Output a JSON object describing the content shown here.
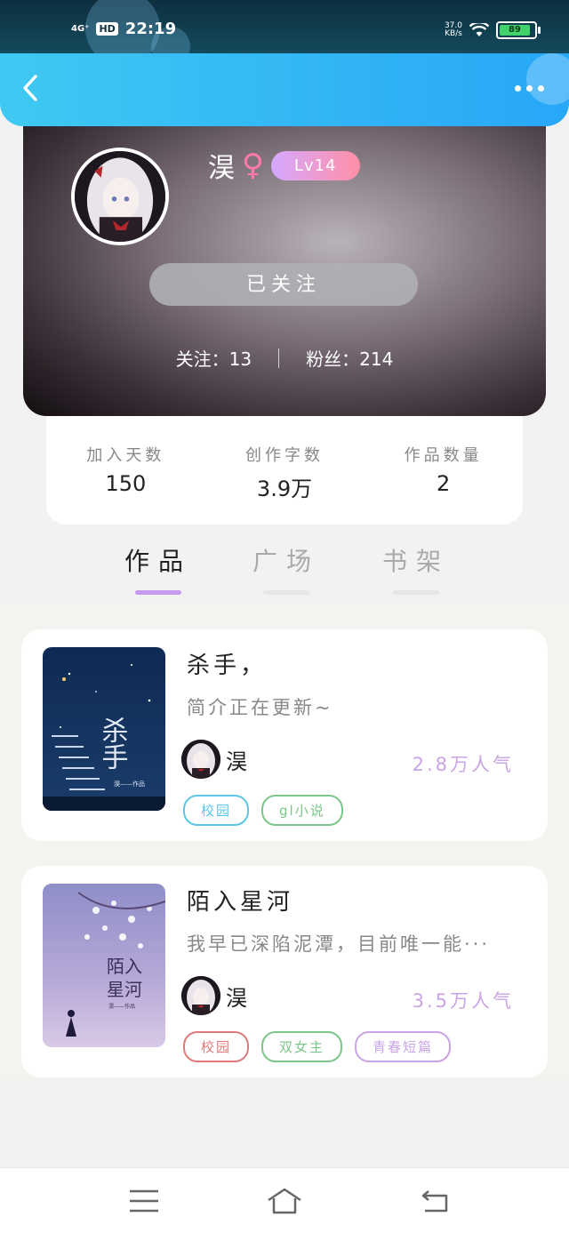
{
  "status_bar": {
    "network": "4G⁺",
    "hd": "HD",
    "time": "22:19",
    "net_speed_value": "37.0",
    "net_speed_unit": "KB/s",
    "battery": "89"
  },
  "profile": {
    "username": "淏",
    "gender_symbol": "♀",
    "level": "Lv14",
    "follow_button": "已关注",
    "following_label": "关注：",
    "following_count": "13",
    "fans_label": "粉丝：",
    "fans_count": "214"
  },
  "stats": [
    {
      "label": "加入天数",
      "value": "150"
    },
    {
      "label": "创作字数",
      "value": "3.9万"
    },
    {
      "label": "作品数量",
      "value": "2"
    }
  ],
  "tabs": [
    {
      "label": "作品",
      "active": true
    },
    {
      "label": "广场",
      "active": false
    },
    {
      "label": "书架",
      "active": false
    }
  ],
  "works": [
    {
      "title": "杀手，",
      "desc": "简介正在更新~",
      "author": "淏",
      "popularity": "2.8万人气",
      "cover_title": "杀手",
      "cover_credit": "淏——作品",
      "tags": [
        {
          "label": "校园",
          "color": "#5bc6e6"
        },
        {
          "label": "gl小说",
          "color": "#7cc68a"
        }
      ]
    },
    {
      "title": "陌入星河",
      "desc": "我早已深陷泥潭，目前唯一能···",
      "author": "淏",
      "popularity": "3.5万人气",
      "cover_title_line1": "陌入",
      "cover_title_line2": "星河",
      "cover_credit": "淏——作品",
      "tags": [
        {
          "label": "校园",
          "color": "#e07a7a"
        },
        {
          "label": "双女主",
          "color": "#7cc68a"
        },
        {
          "label": "青春短篇",
          "color": "#c9a4e6"
        }
      ]
    }
  ],
  "icons": {
    "back": "chevron-left-icon",
    "more": "more-dots-icon",
    "nav_menu": "menu-icon",
    "nav_home": "home-icon",
    "nav_back": "return-icon"
  },
  "colors": {
    "header_start": "#3fc9f2",
    "header_end": "#27a7f7",
    "tab_indicator": "#c79bf0",
    "popularity": "#c9a4e6"
  }
}
